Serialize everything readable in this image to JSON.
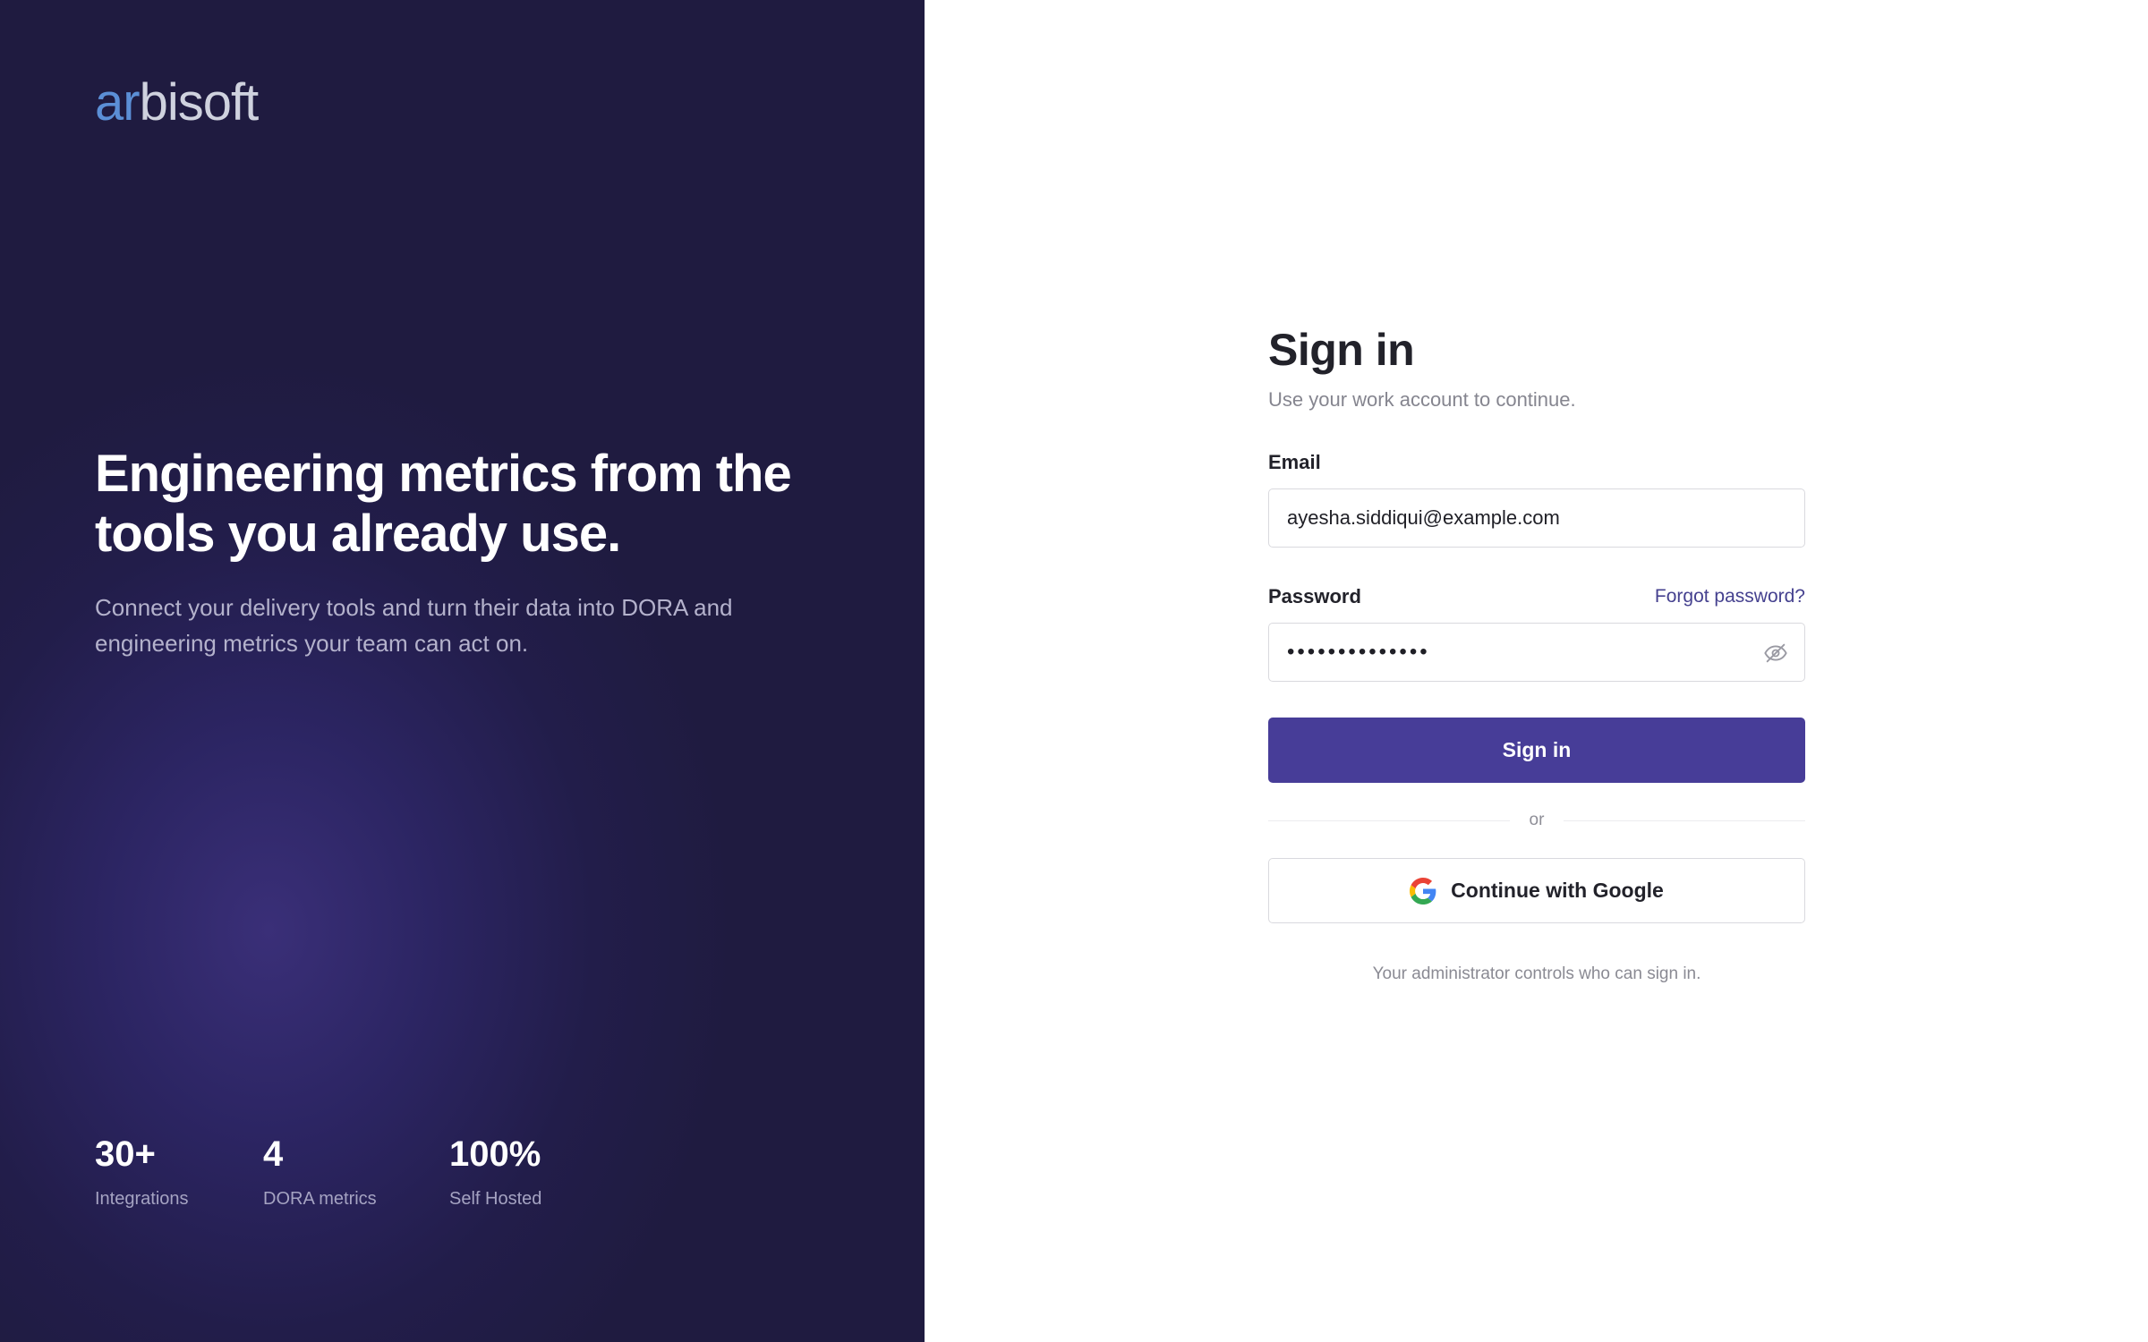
{
  "hero": {
    "logo_accent": "ar",
    "logo_rest": "bisoft",
    "title": "Engineering metrics from the tools you already use.",
    "subtitle": "Connect your delivery tools and turn their data into DORA and engineering metrics your team can act on.",
    "stats": [
      {
        "value": "30+",
        "label": "Integrations"
      },
      {
        "value": "4",
        "label": "DORA metrics"
      },
      {
        "value": "100%",
        "label": "Self Hosted"
      }
    ]
  },
  "signin": {
    "title": "Sign in",
    "subtitle": "Use your work account to continue.",
    "email_label": "Email",
    "email_value": "ayesha.siddiqui@example.com",
    "password_label": "Password",
    "forgot_label": "Forgot password?",
    "password_value": "••••••••••••••",
    "submit_label": "Sign in",
    "divider_text": "or",
    "google_label": "Continue with Google",
    "admin_note": "Your administrator controls who can sign in."
  },
  "icons": {
    "password_toggle": "eye-slash-icon",
    "google": "google-icon"
  },
  "colors": {
    "hero_bg": "#1f1b40",
    "primary": "#473d98",
    "link": "#45418f",
    "logo_accent": "#5b8fd6"
  }
}
